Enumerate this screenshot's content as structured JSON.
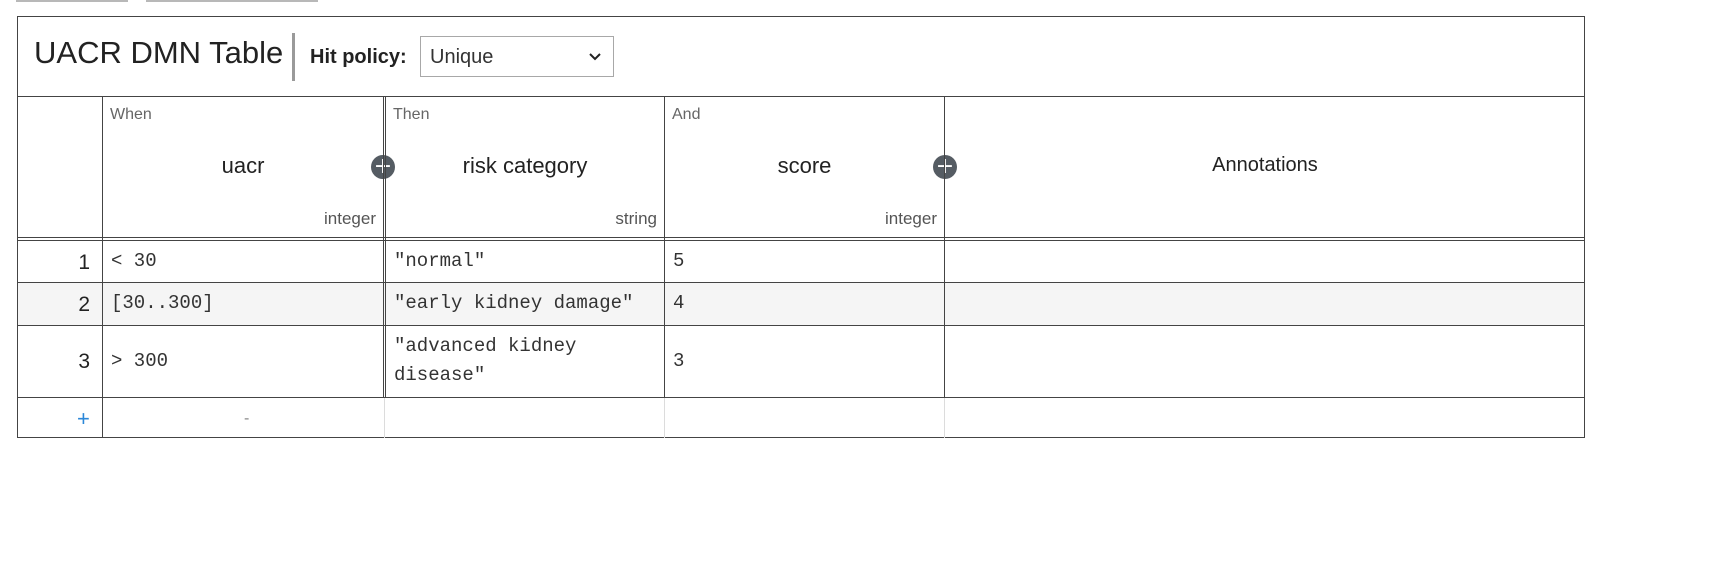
{
  "table": {
    "title": "UACR DMN Table",
    "hit_policy_label": "Hit policy:",
    "hit_policy_value": "Unique"
  },
  "columns": {
    "input": {
      "clause": "When",
      "name": "uacr",
      "type": "integer"
    },
    "output1": {
      "clause": "Then",
      "name": "risk category",
      "type": "string"
    },
    "output2": {
      "clause": "And",
      "name": "score",
      "type": "integer"
    },
    "annotations": {
      "name": "Annotations"
    }
  },
  "rules": [
    {
      "num": "1",
      "uacr": "< 30",
      "risk": "\"normal\"",
      "score": "5",
      "annotation": ""
    },
    {
      "num": "2",
      "uacr": "[30..300]",
      "risk": "\"early kidney damage\"",
      "score": "4",
      "annotation": ""
    },
    {
      "num": "3",
      "uacr": "> 300",
      "risk": "\"advanced kidney disease\"",
      "score": "3",
      "annotation": ""
    }
  ],
  "add_row": {
    "plus": "+",
    "placeholder": "-"
  },
  "icons": {
    "add_column": "plus-circle-icon",
    "dropdown": "chevron-down-icon"
  },
  "colors": {
    "border": "#444444",
    "add_button": "#555c63",
    "add_row_plus": "#2b87d8",
    "shaded_row": "#f5f5f5"
  }
}
